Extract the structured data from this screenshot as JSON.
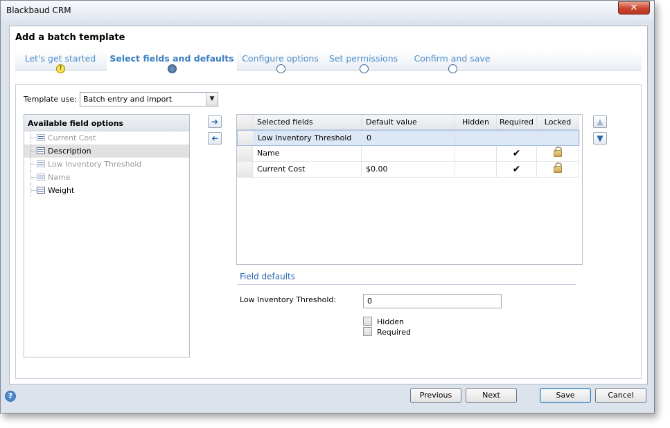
{
  "window": {
    "title": "Blackbaud CRM",
    "close_label": "✕"
  },
  "dialog": {
    "title": "Add a batch template"
  },
  "steps": [
    {
      "label": "Let's get started",
      "state": "warning"
    },
    {
      "label": "Select fields and defaults",
      "state": "active"
    },
    {
      "label": "Configure options",
      "state": "pending"
    },
    {
      "label": "Set permissions",
      "state": "pending"
    },
    {
      "label": "Confirm and save",
      "state": "pending"
    }
  ],
  "template_use": {
    "label": "Template use:",
    "value": "Batch entry and import"
  },
  "available": {
    "header": "Available field options",
    "items": [
      {
        "label": "Current Cost",
        "state": "dim"
      },
      {
        "label": "Description",
        "state": "selected"
      },
      {
        "label": "Low Inventory Threshold",
        "state": "dim"
      },
      {
        "label": "Name",
        "state": "dim"
      },
      {
        "label": "Weight",
        "state": "normal"
      }
    ]
  },
  "grid": {
    "columns": [
      "Selected fields",
      "Default value",
      "Hidden",
      "Required",
      "Locked"
    ],
    "rows": [
      {
        "field": "Low Inventory Threshold",
        "default": "0",
        "hidden": false,
        "required": false,
        "locked": false
      },
      {
        "field": "Name",
        "default": "",
        "hidden": false,
        "required": true,
        "locked": true
      },
      {
        "field": "Current Cost",
        "default": "$0.00",
        "hidden": false,
        "required": true,
        "locked": true
      }
    ],
    "check_glyph": "✔"
  },
  "field_defaults": {
    "title": "Field defaults",
    "threshold_label": "Low Inventory Threshold:",
    "threshold_value": "0",
    "hidden_label": "Hidden",
    "required_label": "Required"
  },
  "footer": {
    "help": "?",
    "previous": "Previous",
    "next": "Next",
    "save": "Save",
    "cancel": "Cancel"
  },
  "colors": {
    "accent": "#4f8ec7",
    "link": "#2a66b0",
    "selected_row": "#dde8f6"
  }
}
